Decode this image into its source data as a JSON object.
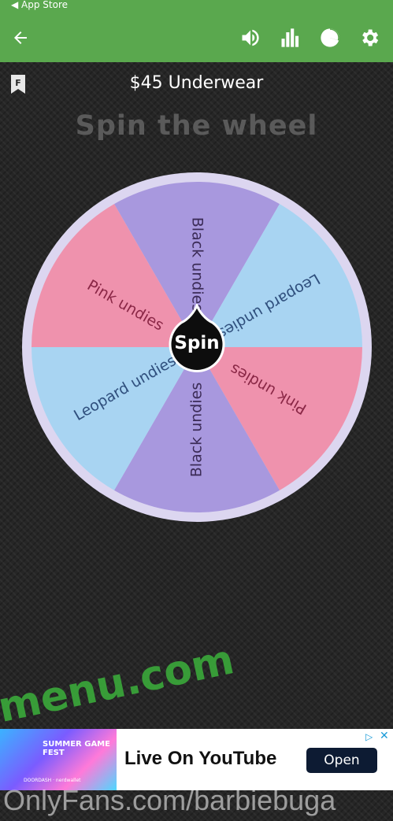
{
  "status_bar": {
    "back_label": "◀ App Store"
  },
  "toolbar": {
    "back_icon": "arrow-left-icon",
    "sound_icon": "speaker-icon",
    "stats_icon": "bar-chart-icon",
    "pie_icon": "pie-chart-icon",
    "settings_icon": "gear-icon"
  },
  "wheel": {
    "name": "$45 Underwear",
    "heading": "Spin the wheel",
    "spin_label": "Spin",
    "segments": [
      {
        "label": "Black undies",
        "color": "#a898de"
      },
      {
        "label": "Leopard undies",
        "color": "#a8d4f2"
      },
      {
        "label": "Pink undies",
        "color": "#ef92ad"
      },
      {
        "label": "Black undies",
        "color": "#a898de"
      },
      {
        "label": "Leopard undies",
        "color": "#a8d4f2"
      },
      {
        "label": "Pink undies",
        "color": "#ef92ad"
      }
    ],
    "label_colors": {
      "#a898de": "#3b2b57",
      "#a8d4f2": "#2f4f7d",
      "#ef92ad": "#8a2746"
    }
  },
  "watermarks": {
    "menu": "menu.com",
    "onlyfans": "OnlyFans.com/barbiebuga"
  },
  "ad": {
    "image_title": "SUMMER GAME FEST",
    "image_sponsors": "DOORDASH · nerdwallet",
    "text": "Live On YouTube",
    "button": "Open"
  }
}
